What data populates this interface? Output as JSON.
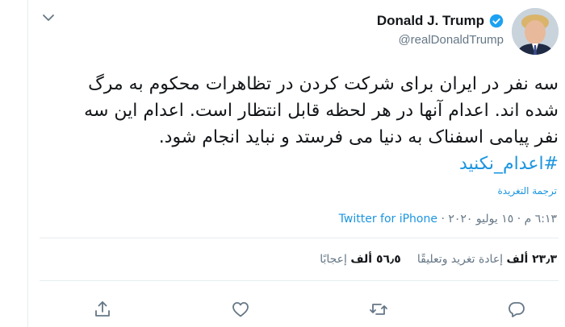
{
  "author": {
    "display_name": "Donald J. Trump",
    "handle": "@realDonaldTrump"
  },
  "tweet": {
    "text_main": "سه نفر در ایران برای شرکت کردن در تظاهرات محکوم به مرگ شده اند. اعدام آنها در هر لحظه قابل انتظار است. اعدام این سه نفر پیامی اسفناک به دنیا می فرستد و نباید انجام شود. ",
    "hashtag": "#اعدام_نکنید",
    "translate_label": "ترجمة التغريدة"
  },
  "meta": {
    "timestamp": "٦:١٣ م · ١٥ يوليو ٢٠٢٠ · ",
    "source": "Twitter for iPhone"
  },
  "stats": {
    "retweets_count": "٢٣٫٣ ألف",
    "retweets_label": "إعادة تغريد وتعليقًا",
    "likes_count": "٥٦٫٥ ألف",
    "likes_label": "إعجابًا"
  },
  "icons": {
    "chevron": "chevron-down-icon",
    "verified": "verified-badge-icon",
    "reply": "reply-icon",
    "retweet": "retweet-icon",
    "like": "heart-icon",
    "share": "share-icon"
  },
  "colors": {
    "link": "#1b95e0",
    "muted": "#657786",
    "text": "#14171a",
    "verified": "#1da1f2"
  }
}
